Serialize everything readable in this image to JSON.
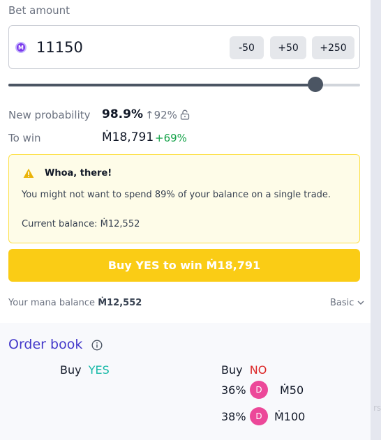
{
  "bet": {
    "label": "Bet amount",
    "amount": "11150",
    "mana_symbol": "M",
    "increments": [
      "-50",
      "+50",
      "+250"
    ],
    "slider_fraction": 0.873
  },
  "stats": {
    "probability_label": "New probability",
    "probability_value": "98.9%",
    "probability_change": "↑92%",
    "win_label": "To win",
    "win_value": "Ṁ18,791",
    "win_change": "+69%"
  },
  "warning": {
    "title": "Whoa, there!",
    "body": "You might not want to spend 89% of your balance on a single trade.",
    "balance": "Current balance: Ṁ12,552"
  },
  "buy_button": "Buy YES to win Ṁ18,791",
  "footer": {
    "balance_prefix": "Your mana balance",
    "balance_value": "Ṁ12,552",
    "mode": "Basic"
  },
  "order_book": {
    "title": "Order book",
    "buy_label": "Buy",
    "yes_label": "YES",
    "no_label": "NO",
    "no_orders": [
      {
        "prob": "36%",
        "avatar": "D",
        "amount": "Ṁ50"
      },
      {
        "prob": "38%",
        "avatar": "D",
        "amount": "Ṁ100"
      }
    ]
  },
  "rail_text": "rs",
  "colors": {
    "accent": "#4338ca",
    "yes": "#14b8a6",
    "no": "#dc2626",
    "buy_button": "#facc15",
    "warning_bg": "#fefce8",
    "avatar": "#ec4899"
  }
}
